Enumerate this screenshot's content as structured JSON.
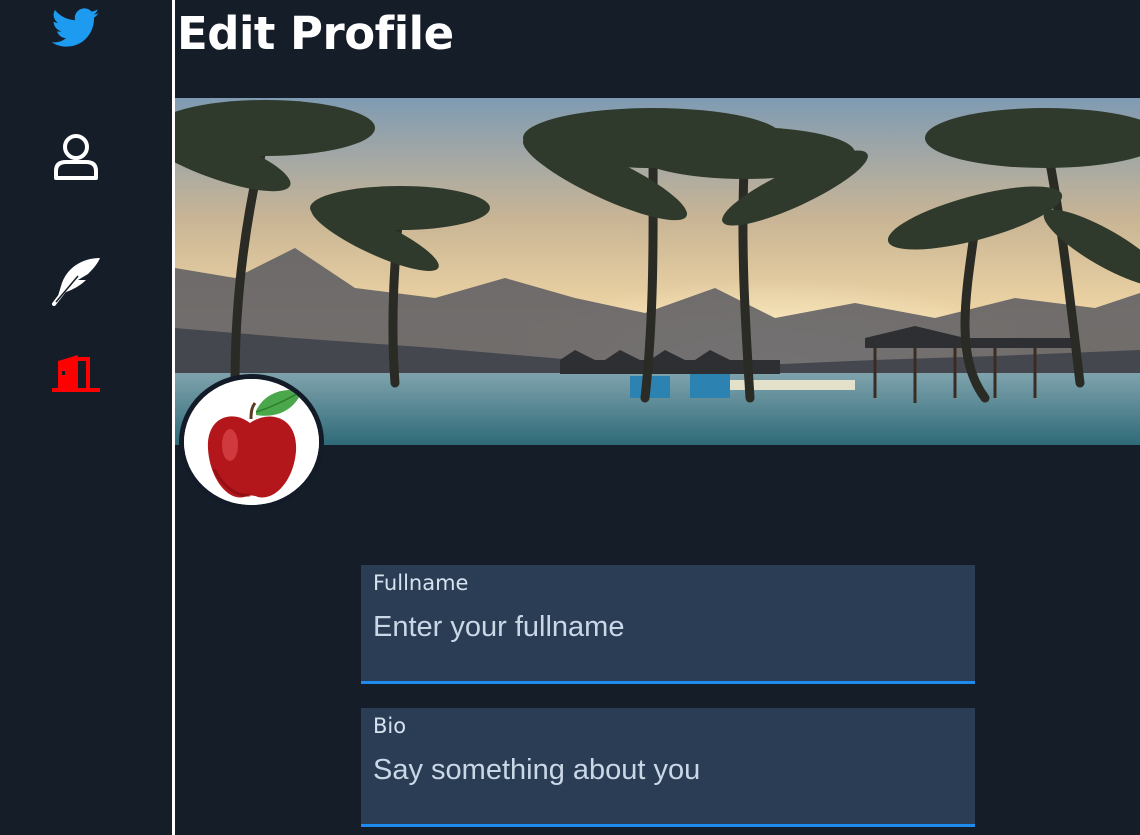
{
  "sidebar": {
    "icons": [
      {
        "name": "twitter-bird-icon",
        "color": "#1d9bf0"
      },
      {
        "name": "user-profile-icon",
        "color": "#ffffff"
      },
      {
        "name": "feather-quill-icon",
        "color": "#ffffff"
      },
      {
        "name": "logout-door-icon",
        "color": "#ff0000"
      }
    ]
  },
  "page": {
    "title": "Edit Profile"
  },
  "banner": {
    "image": "tropical-beach-palm-trees-sunset"
  },
  "avatar": {
    "image": "red-apple"
  },
  "form": {
    "fullname": {
      "label": "Fullname",
      "placeholder": "Enter your fullname",
      "value": ""
    },
    "bio": {
      "label": "Bio",
      "placeholder": "Say something about you",
      "value": ""
    }
  },
  "colors": {
    "background": "#151d28",
    "field_background": "#2b3d54",
    "accent": "#1d8bf0",
    "logout": "#ff0000"
  }
}
